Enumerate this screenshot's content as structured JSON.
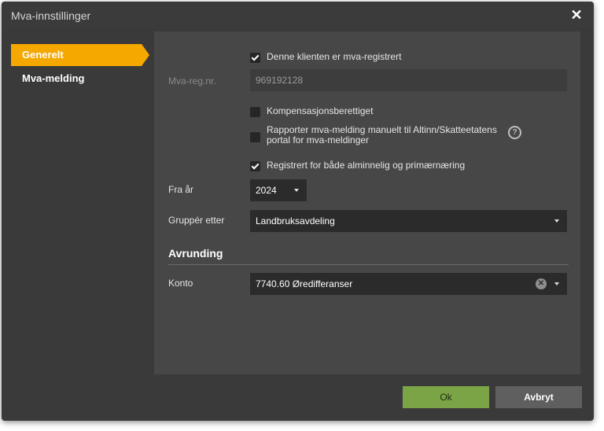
{
  "dialog": {
    "title": "Mva-innstillinger",
    "close_glyph": "✕"
  },
  "sidebar": {
    "items": [
      {
        "label": "Generelt",
        "active": true
      },
      {
        "label": "Mva-melding",
        "active": false
      }
    ]
  },
  "form": {
    "mva_registered": {
      "label": "Denne klienten er mva-registrert",
      "checked": true
    },
    "mva_reg_nr": {
      "label": "Mva-reg.nr.",
      "value": "969192128"
    },
    "kompensasjon": {
      "label": "Kompensasjonsberettiget",
      "checked": false
    },
    "rapporter": {
      "label_line1": "Rapporter mva-melding manuelt til Altinn/Skatteetatens",
      "label_line2": "portal for mva-meldinger",
      "checked": false,
      "help_glyph": "?"
    },
    "registrert_begge": {
      "label": "Registrert for både alminnelig og primærnæring",
      "checked": true
    },
    "fra_ar": {
      "label": "Fra år",
      "value": "2024"
    },
    "grupper_etter": {
      "label": "Gruppér etter",
      "value": "Landbruksavdeling"
    }
  },
  "avrunding": {
    "heading": "Avrunding",
    "konto": {
      "label": "Konto",
      "value": "7740.60 Øredifferanser",
      "clear_glyph": "✕"
    }
  },
  "buttons": {
    "ok": "Ok",
    "cancel": "Avbryt"
  },
  "colors": {
    "accent": "#f5a800",
    "ok_button": "#7aa446",
    "panel": "#474747"
  },
  "icons": [
    "close-icon",
    "checkmark-icon",
    "help-icon",
    "chevron-down-icon",
    "clear-icon"
  ]
}
